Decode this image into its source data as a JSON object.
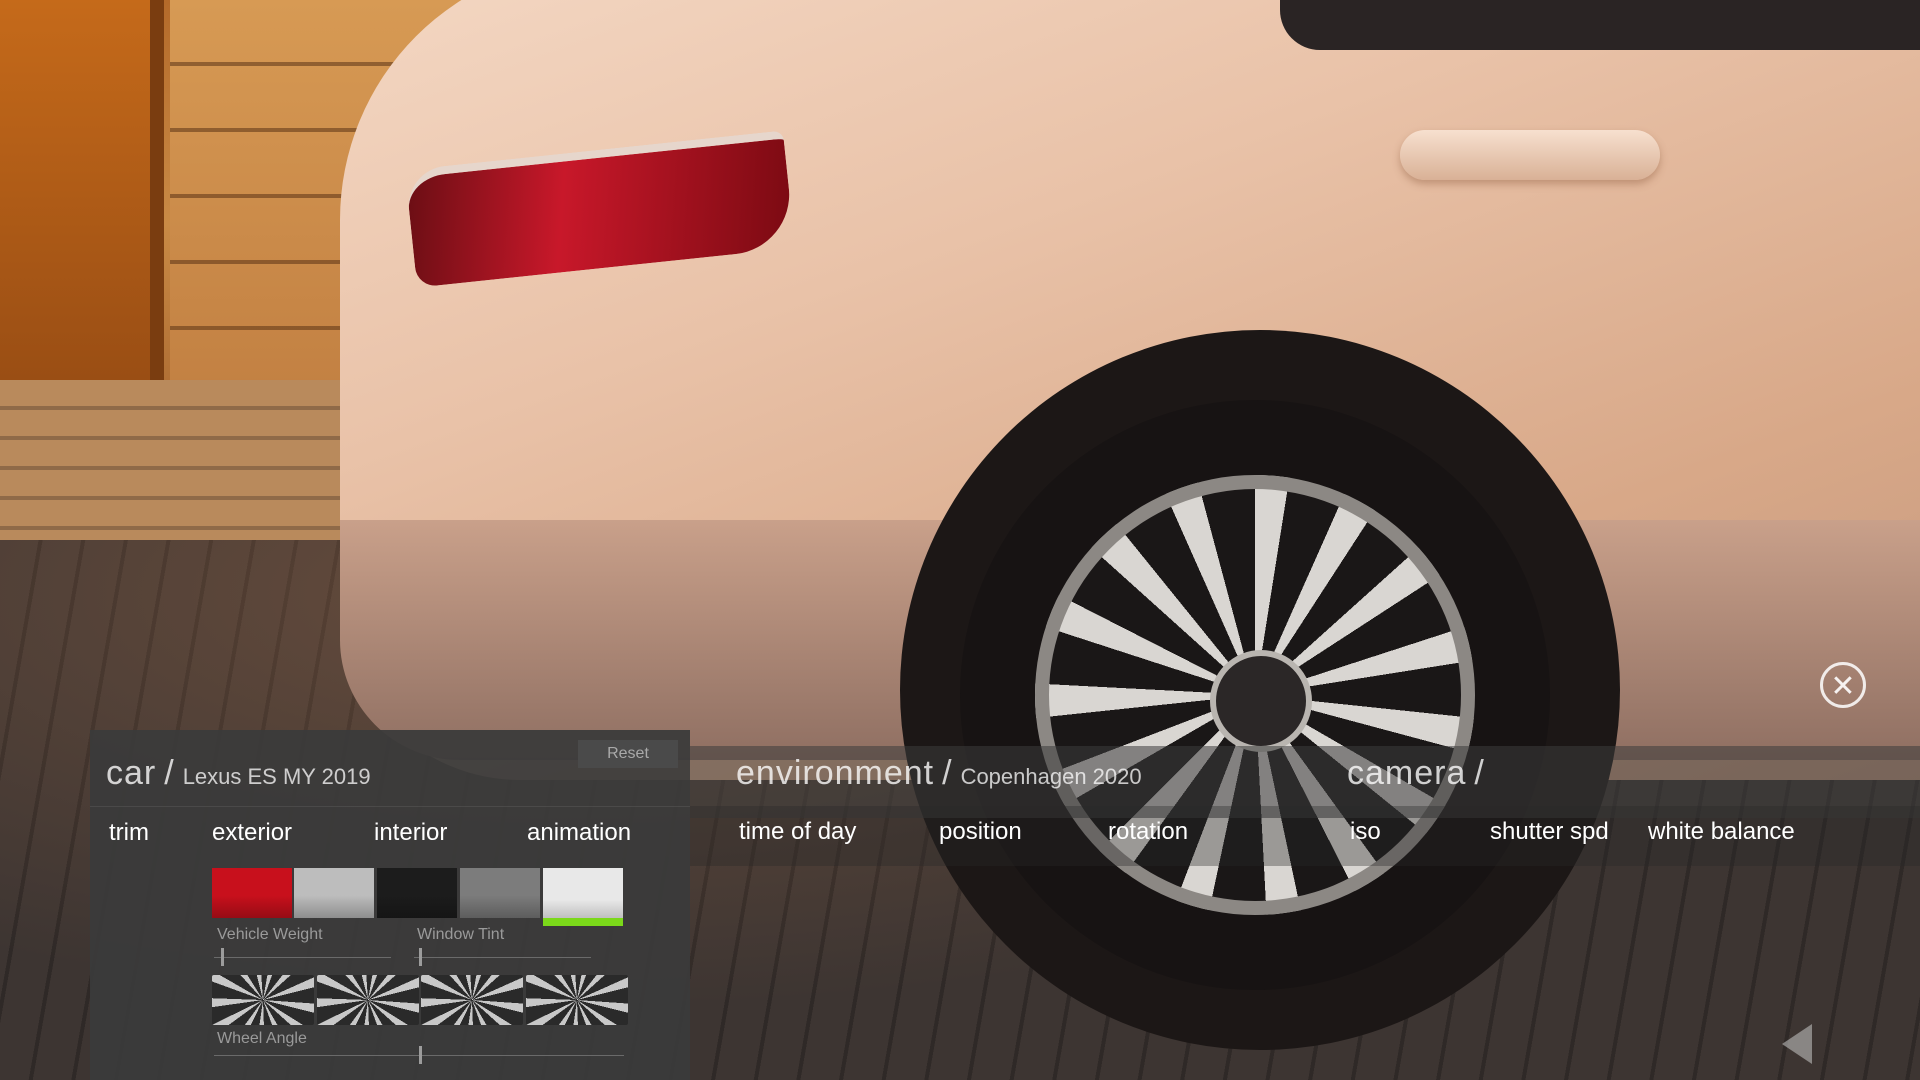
{
  "car_section": {
    "title": "car",
    "subtitle": "Lexus ES MY 2019",
    "reset_label": "Reset",
    "tabs": [
      "trim",
      "exterior",
      "interior",
      "animation"
    ],
    "swatches": [
      {
        "name": "red",
        "color": "#c8101c",
        "selected": false
      },
      {
        "name": "silver",
        "color": "#bdbdbd",
        "selected": false
      },
      {
        "name": "black",
        "color": "#1c1c1c",
        "selected": false
      },
      {
        "name": "dark-silver",
        "color": "#7c7c7c",
        "selected": false
      },
      {
        "name": "white",
        "color": "#e8e8e8",
        "selected": true
      }
    ],
    "accent_color": "#7bd81a",
    "sliders": {
      "vehicle_weight": {
        "label": "Vehicle Weight",
        "value": 0.04
      },
      "window_tint": {
        "label": "Window Tint",
        "value": 0.03
      },
      "wheel_angle": {
        "label": "Wheel Angle",
        "value": 0.5
      }
    },
    "wheel_options": [
      "wheel-option-1",
      "wheel-option-2",
      "wheel-option-3",
      "wheel-option-4"
    ]
  },
  "environment_section": {
    "title": "environment",
    "subtitle": "Copenhagen 2020",
    "tabs": [
      "time of day",
      "position",
      "rotation"
    ]
  },
  "camera_section": {
    "title": "camera",
    "tabs": [
      "iso",
      "shutter spd",
      "white balance"
    ]
  },
  "controls": {
    "close_icon": "close-icon",
    "back_icon": "back-arrow-icon"
  }
}
